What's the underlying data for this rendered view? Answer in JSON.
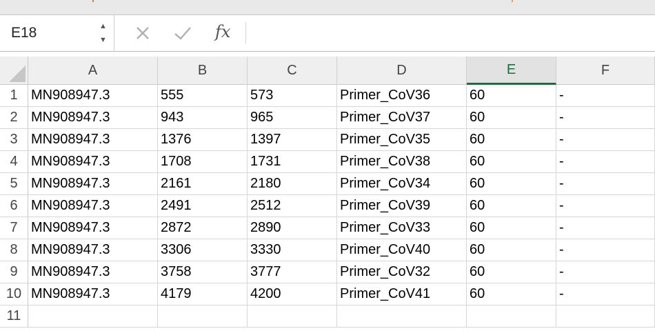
{
  "formula_bar": {
    "name_box": "E18",
    "stepper_up_icon": "triangle-up-icon",
    "stepper_down_icon": "triangle-down-icon",
    "cancel_icon": "x-icon",
    "confirm_icon": "checkmark-icon",
    "function_label": "fx",
    "formula_value": ""
  },
  "colors": {
    "selected_header_accent": "#1e6b3c",
    "top_strip_mark": "#e07a2e"
  },
  "sheet": {
    "selected_cell": "E18",
    "columns": [
      "A",
      "B",
      "C",
      "D",
      "E",
      "F"
    ],
    "selected_column": "E",
    "row_numbers": [
      "1",
      "2",
      "3",
      "4",
      "5",
      "6",
      "7",
      "8",
      "9",
      "10",
      "11"
    ],
    "rows": [
      [
        "MN908947.3",
        "555",
        "573",
        "Primer_CoV36",
        "60",
        "-"
      ],
      [
        "MN908947.3",
        "943",
        "965",
        "Primer_CoV37",
        "60",
        "-"
      ],
      [
        "MN908947.3",
        "1376",
        "1397",
        "Primer_CoV35",
        "60",
        "-"
      ],
      [
        "MN908947.3",
        "1708",
        "1731",
        "Primer_CoV38",
        "60",
        "-"
      ],
      [
        "MN908947.3",
        "2161",
        "2180",
        "Primer_CoV34",
        "60",
        "-"
      ],
      [
        "MN908947.3",
        "2491",
        "2512",
        "Primer_CoV39",
        "60",
        "-"
      ],
      [
        "MN908947.3",
        "2872",
        "2890",
        "Primer_CoV33",
        "60",
        "-"
      ],
      [
        "MN908947.3",
        "3306",
        "3330",
        "Primer_CoV40",
        "60",
        "-"
      ],
      [
        "MN908947.3",
        "3758",
        "3777",
        "Primer_CoV32",
        "60",
        "-"
      ],
      [
        "MN908947.3",
        "4179",
        "4200",
        "Primer_CoV41",
        "60",
        "-"
      ],
      [
        "",
        "",
        "",
        "",
        "",
        ""
      ]
    ]
  }
}
